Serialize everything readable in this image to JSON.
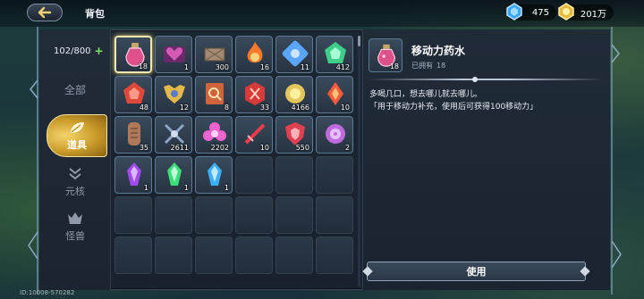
{
  "header": {
    "title": "背包",
    "resources": [
      {
        "name": "blue-gem",
        "value": "475",
        "color": "#4fb7ff"
      },
      {
        "name": "gold-coin",
        "value": "201万",
        "color": "#f2cf4a"
      }
    ]
  },
  "sidebar": {
    "capacity": "102/800",
    "categories": [
      {
        "label": "全部",
        "active": false
      },
      {
        "label": "道具",
        "active": true
      },
      {
        "label": "元核",
        "active": false
      },
      {
        "label": "怪兽",
        "active": false
      }
    ]
  },
  "inventory": {
    "slots": [
      {
        "icon": "mobility-potion-icon",
        "count": "18",
        "color": "#e0508a",
        "selected": true
      },
      {
        "icon": "heart-charm-icon",
        "count": "1",
        "color": "#d35bb5"
      },
      {
        "icon": "wooden-crate-icon",
        "count": "300",
        "color": "#a48a72"
      },
      {
        "icon": "fire-orb-icon",
        "count": "16",
        "color": "#ff7a2a"
      },
      {
        "icon": "blue-puzzle-icon",
        "count": "11",
        "color": "#5aa6ff"
      },
      {
        "icon": "green-pendant-icon",
        "count": "412",
        "color": "#3fcf8a"
      },
      {
        "icon": "red-pentagon-icon",
        "count": "48",
        "color": "#e0483a"
      },
      {
        "icon": "gold-badge-icon",
        "count": "12",
        "color": "#e6b84a"
      },
      {
        "icon": "search-book-icon",
        "count": "8",
        "color": "#d0643a"
      },
      {
        "icon": "red-hex-emblem-icon",
        "count": "33",
        "color": "#d83a3a"
      },
      {
        "icon": "gold-medal-icon",
        "count": "4166",
        "color": "#e3c55a"
      },
      {
        "icon": "flame-crystal-icon",
        "count": "10",
        "color": "#ff5a3a"
      },
      {
        "icon": "stone-tablet-icon",
        "count": "35",
        "color": "#b07a5a"
      },
      {
        "icon": "crossed-swords-icon",
        "count": "2611",
        "color": "#8fa6c4"
      },
      {
        "icon": "pink-flower-icon",
        "count": "2202",
        "color": "#ee63d0"
      },
      {
        "icon": "red-sword-icon",
        "count": "10",
        "color": "#f03a4a"
      },
      {
        "icon": "red-shield-icon",
        "count": "550",
        "color": "#e04050"
      },
      {
        "icon": "purple-rose-icon",
        "count": "2",
        "color": "#c06ae0"
      },
      {
        "icon": "purple-crystal-icon",
        "count": "1",
        "color": "#a24af0"
      },
      {
        "icon": "green-crystal-icon",
        "count": "1",
        "color": "#3adf7a"
      },
      {
        "icon": "blue-crystal-icon",
        "count": "1",
        "color": "#3ab0ff"
      },
      {
        "icon": "",
        "count": ""
      },
      {
        "icon": "",
        "count": ""
      },
      {
        "icon": "",
        "count": ""
      },
      {
        "icon": "",
        "count": ""
      },
      {
        "icon": "",
        "count": ""
      },
      {
        "icon": "",
        "count": ""
      },
      {
        "icon": "",
        "count": ""
      },
      {
        "icon": "",
        "count": ""
      },
      {
        "icon": "",
        "count": ""
      },
      {
        "icon": "",
        "count": ""
      },
      {
        "icon": "",
        "count": ""
      },
      {
        "icon": "",
        "count": ""
      },
      {
        "icon": "",
        "count": ""
      },
      {
        "icon": "",
        "count": ""
      },
      {
        "icon": "",
        "count": ""
      }
    ]
  },
  "detail": {
    "name": "移动力药水",
    "owned_label": "已拥有",
    "owned_count": "18",
    "icon_count": "18",
    "desc_line1": "多喝几口，想去哪儿就去哪儿。",
    "desc_line2": "「用于移动力补充，使用后可获得100移动力」",
    "use_label": "使用"
  },
  "footer": {
    "id_text": "ID:10008-570282"
  }
}
